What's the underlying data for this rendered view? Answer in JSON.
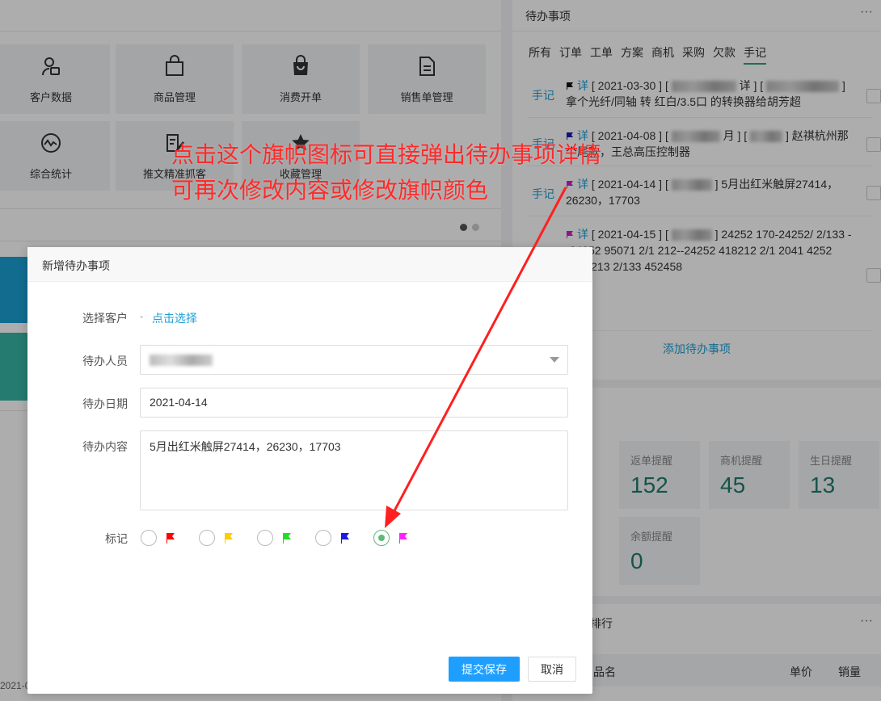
{
  "dashboard": {
    "tiles": [
      {
        "label": "客户数据",
        "icon": "user-card-icon"
      },
      {
        "label": "商品管理",
        "icon": "bag-icon"
      },
      {
        "label": "消费开单",
        "icon": "shopping-bag-icon"
      },
      {
        "label": "销售单管理",
        "icon": "document-icon"
      },
      {
        "label": "综合统计",
        "icon": "pulse-icon"
      },
      {
        "label": "推文精准抓客",
        "icon": "edit-doc-icon"
      },
      {
        "label": "收藏管理",
        "icon": "star-icon"
      }
    ]
  },
  "todo_panel": {
    "title": "待办事项",
    "more": "···",
    "tabs": [
      "所有",
      "订单",
      "工单",
      "方案",
      "商机",
      "采购",
      "欠款",
      "手记"
    ],
    "active_tab": "手记",
    "items": [
      {
        "category": "手记",
        "flag_color": "#111111",
        "detail": "详",
        "date": "[ 2021-03-30 ] [",
        "mid": "详 ] [",
        "text": "] 拿个光纤/同轴 转 红白/3.5口 的转换器给胡芳超"
      },
      {
        "category": "手记",
        "flag_color": "#1a1aa8",
        "detail": "详",
        "date": "[ 2021-04-08 ] [",
        "mid": "月 ] [",
        "text": "] 赵祺杭州那个尾款，王总高压控制器"
      },
      {
        "category": "手记",
        "flag_color": "#cc22cc",
        "detail": "详",
        "date": "[ 2021-04-14 ] [",
        "mid": "",
        "text": "] 5月出红米触屏27414，26230，17703"
      },
      {
        "category": "手记",
        "flag_color": "#cc22cc",
        "detail": "详",
        "date": "[ 2021-04-15 ] [",
        "mid": "",
        "text": "] 24252 170-24252/ 2/133 --24252 95071 2/1 212--24252 418212 2/1 2041 4252 0419213 2/133 452458"
      }
    ],
    "add_label": "添加待办事项"
  },
  "stats": [
    {
      "label": "返单提醒",
      "value": "152"
    },
    {
      "label": "商机提醒",
      "value": "45"
    },
    {
      "label": "生日提醒",
      "value": "13"
    },
    {
      "label": "余额提醒",
      "value": "0"
    }
  ],
  "rank_panel": {
    "title": "排行",
    "more": "···",
    "columns": [
      "品名",
      "单价",
      "销量"
    ]
  },
  "chart_fragment": {
    "date_label": "2021-0"
  },
  "modal": {
    "title": "新增待办事项",
    "customer_label": "选择客户",
    "customer_dash": "-",
    "customer_link": "点击选择",
    "person_label": "待办人员",
    "date_label": "待办日期",
    "date_value": "2021-04-14",
    "content_label": "待办内容",
    "content_value": "5月出红米触屏27414，26230，17703",
    "mark_label": "标记",
    "flag_options": [
      {
        "color": "#ff0000",
        "checked": false,
        "icon": "red-flag-icon"
      },
      {
        "color": "#ffcc00",
        "checked": false,
        "icon": "yellow-flag-icon"
      },
      {
        "color": "#22dd22",
        "checked": false,
        "icon": "green-flag-icon"
      },
      {
        "color": "#1a1ae0",
        "checked": false,
        "icon": "blue-flag-icon"
      },
      {
        "color": "#ff22ff",
        "checked": true,
        "icon": "magenta-flag-icon"
      }
    ],
    "submit_label": "提交保存",
    "cancel_label": "取消"
  },
  "annotation": {
    "line1": "点击这个旗帜图标可直接弹出待办事项详情",
    "line2": "可再次修改内容或修改旗帜颜色",
    "color": "#ff2a2a"
  }
}
